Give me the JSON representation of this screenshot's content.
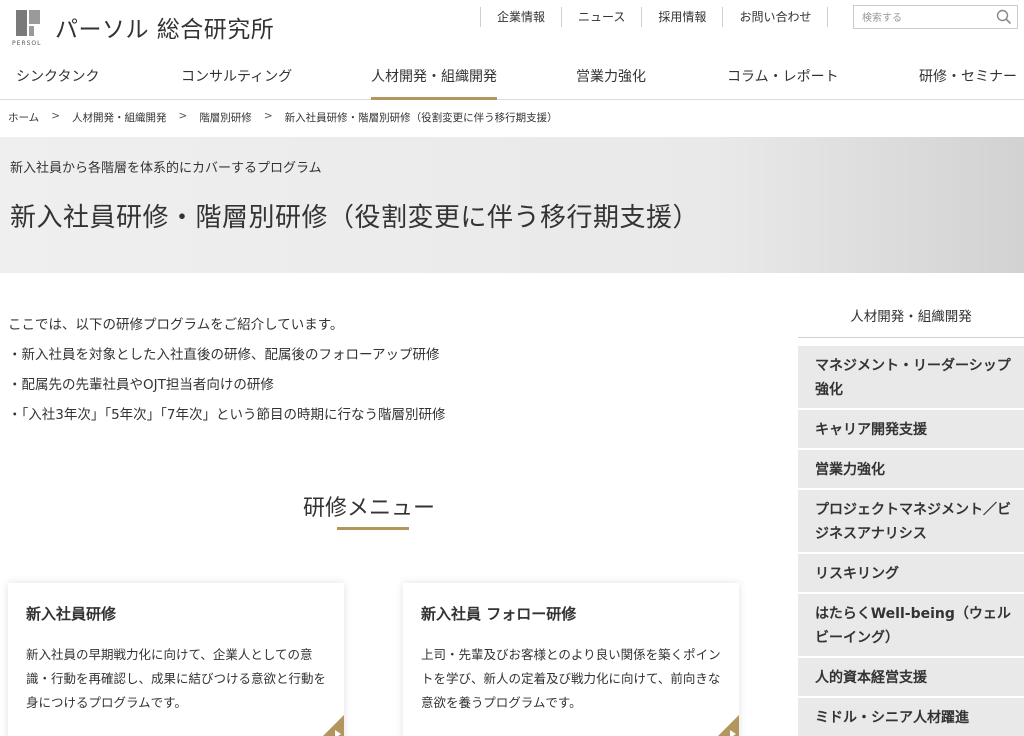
{
  "header": {
    "logo_text": "パーソル 総合研究所",
    "logo_sub": "PERSOL",
    "utility_links": [
      "企業情報",
      "ニュース",
      "採用情報",
      "お問い合わせ"
    ],
    "search_placeholder": "検索する"
  },
  "gnav": {
    "items": [
      "シンクタンク",
      "コンサルティング",
      "人材開発・組織開発",
      "営業力強化",
      "コラム・レポート",
      "研修・セミナー"
    ],
    "active": "人材開発・組織開発"
  },
  "breadcrumb": [
    "ホーム",
    "人材開発・組織開発",
    "階層別研修",
    "新入社員研修・階層別研修（役割変更に伴う移行期支援）"
  ],
  "hero": {
    "subtitle": "新入社員から各階層を体系的にカバーするプログラム",
    "title": "新入社員研修・階層別研修（役割変更に伴う移行期支援）"
  },
  "intro": [
    "ここでは、以下の研修プログラムをご紹介しています。",
    "・新入社員を対象とした入社直後の研修、配属後のフォローアップ研修",
    "・配属先の先輩社員やOJT担当者向けの研修",
    "・「入社3年次」「5年次」「7年次」という節目の時期に行なう階層別研修"
  ],
  "menu": {
    "heading": "研修メニュー",
    "cards": [
      {
        "title": "新入社員研修",
        "desc": "新入社員の早期戦力化に向けて、企業人としての意識・行動を再確認し、成果に結びつける意欲と行動を身につけるプログラムです。"
      },
      {
        "title": "新入社員 フォロー研修",
        "desc": "上司・先輩及びお客様とのより良い関係を築くポイントを学び、新人の定着及び戦力化に向けて、前向きな意欲を養うプログラムです。"
      }
    ]
  },
  "sidebar": {
    "title": "人材開発・組織開発",
    "items": [
      "マネジメント・リーダーシップ強化",
      "キャリア開発支援",
      "営業力強化",
      "プロジェクトマネジメント／ビジネスアナリシス",
      "リスキリング",
      "はたらくWell-being（ウェルビーイング）",
      "人的資本経営支援",
      "ミドル・シニア人材躍進"
    ]
  },
  "colors": {
    "accent": "#b2965e",
    "sidebar_bg": "#e9e9e9",
    "text": "#333333"
  }
}
